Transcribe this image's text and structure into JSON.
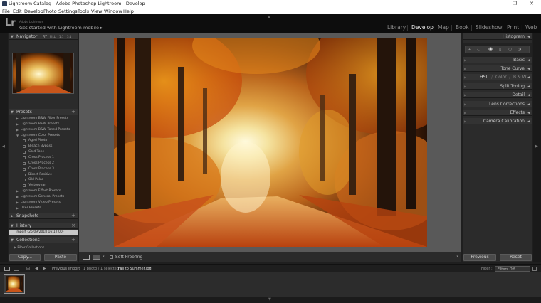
{
  "window": {
    "title": "Lightroom Catalog - Adobe Photoshop Lightroom - Develop",
    "minimize": "—",
    "maximize": "❐",
    "close": "✕"
  },
  "menu": [
    "File",
    "Edit",
    "Develop",
    "Photo",
    "Settings",
    "Tools",
    "View",
    "Window",
    "Help"
  ],
  "identity": {
    "logo": "Lr",
    "small": "Adobe Lightroom",
    "main": "Get started with Lightroom mobile ▸"
  },
  "modules": [
    "Library",
    "Develop",
    "Map",
    "Book",
    "Slideshow",
    "Print",
    "Web"
  ],
  "active_module": "Develop",
  "left": {
    "navigator": {
      "label": "Navigator",
      "zoom": [
        "FIT",
        "FILL",
        "1:1",
        "3:1"
      ]
    },
    "presets_label": "Presets",
    "presets": [
      {
        "name": "Lightroom B&W Filter Presets",
        "sub": false,
        "open": false
      },
      {
        "name": "Lightroom B&W Presets",
        "sub": false,
        "open": false
      },
      {
        "name": "Lightroom B&W Toned Presets",
        "sub": false,
        "open": false
      },
      {
        "name": "Lightroom Color Presets",
        "sub": false,
        "open": true
      },
      {
        "name": "Aged Photo",
        "sub": true
      },
      {
        "name": "Bleach Bypass",
        "sub": true
      },
      {
        "name": "Cold Tone",
        "sub": true
      },
      {
        "name": "Cross Process 1",
        "sub": true
      },
      {
        "name": "Cross Process 2",
        "sub": true
      },
      {
        "name": "Cross Process 3",
        "sub": true
      },
      {
        "name": "Direct Positive",
        "sub": true
      },
      {
        "name": "Old Polar",
        "sub": true
      },
      {
        "name": "Yesteryear",
        "sub": true
      },
      {
        "name": "Lightroom Effect Presets",
        "sub": false,
        "open": false
      },
      {
        "name": "Lightroom General Presets",
        "sub": false,
        "open": false
      },
      {
        "name": "Lightroom Video Presets",
        "sub": false,
        "open": false
      },
      {
        "name": "User Presets",
        "sub": false,
        "open": false
      }
    ],
    "snapshots_label": "Snapshots",
    "history_label": "History",
    "history_item": "Import (25/09/2018 16:12:00)",
    "collections_label": "Collections",
    "filter_collections": "Filter Collections",
    "copy": "Copy...",
    "paste": "Paste"
  },
  "toolbar": {
    "soft_proofing": "Soft Proofing"
  },
  "right": {
    "histogram": "Histogram",
    "sections": [
      "Basic",
      "Tone Curve",
      "",
      "Split Toning",
      "Detail",
      "Lens Corrections",
      "Effects",
      "Camera Calibration"
    ],
    "hsl": [
      "HSL",
      "Color",
      "B & W"
    ],
    "previous": "Previous",
    "reset": "Reset"
  },
  "filmstrip": {
    "source": "Previous Import",
    "info": "1 photo / 1 selected /",
    "filename": "Fall to Summer.jpg",
    "filter_label": "Filter :",
    "filter_value": "Filters Off"
  },
  "colors": {
    "accent_orange": "#e07a1a",
    "panel_bg": "#2b2b2b",
    "center_bg": "#595959"
  }
}
